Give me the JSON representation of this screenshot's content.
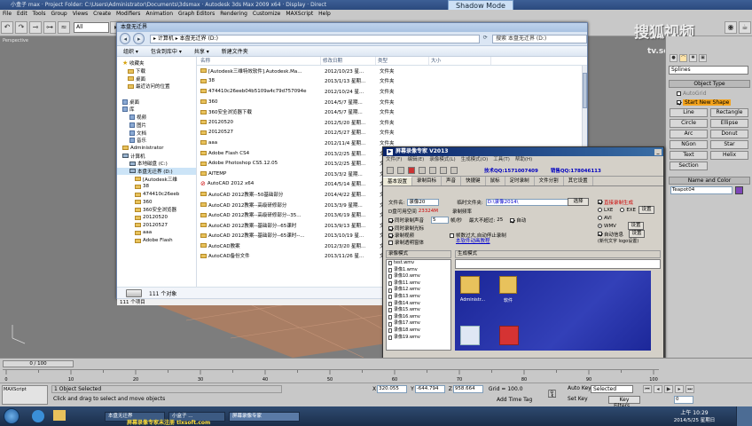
{
  "max": {
    "title": "小盒子 max  ·  Project Folder: C:\\Users\\Administrator\\Documents\\3dsmax  ·  Autodesk 3ds Max  2009 x64  ·  Display  ·  Direct",
    "menu": [
      "File",
      "Edit",
      "Tools",
      "Group",
      "Views",
      "Create",
      "Modifiers",
      "Animation",
      "Graph Editors",
      "Rendering",
      "Customize",
      "MAXScript",
      "Help"
    ],
    "shadow_mode": "Shadow Mode",
    "selection_filter": "All",
    "viewport_label": "Perspective",
    "watermark": "搜狐视频",
    "watermark_url": "tv.sohu.com",
    "cmd_dropdown": "Splines",
    "object_type_header": "Object Type",
    "autogrid": "AutoGrid",
    "start_new_shape": "Start New Shape",
    "shape_buttons": [
      "Line",
      "Rectangle",
      "Circle",
      "Ellipse",
      "Arc",
      "Donut",
      "NGon",
      "Star",
      "Text",
      "Helix",
      "Section"
    ],
    "name_color_header": "Name and Color",
    "object_name": "Teapot04",
    "time_slider": "0 / 100",
    "ruler_ticks": [
      "0",
      "10",
      "20",
      "30",
      "40",
      "50",
      "60",
      "70",
      "80",
      "90",
      "100"
    ],
    "maxscript_label": "MAXScript",
    "status_selected": "1 Object Selected",
    "status_prompt": "Click and drag to select and move objects",
    "coord_x": "320.055",
    "coord_y": "-644.794",
    "coord_z": "958.664",
    "grid": "Grid = 100.0",
    "add_time_tag": "Add Time Tag",
    "auto_key": "Auto Key",
    "auto_key_value": "Selected",
    "set_key": "Set Key",
    "key_filters": "Key Filters...",
    "frame_value": "0",
    "accent_color": "#f4a31b"
  },
  "explorer": {
    "caption": "本盘无迁界",
    "breadcrumb": "▸ 计算机 ▸ 本盘无迁界 (D:)",
    "search_placeholder": "搜索 本盘无迁界 (D:)",
    "commands": [
      "组织 ▾",
      "包含到库中 ▾",
      "共享 ▾",
      "新建文件夹"
    ],
    "columns": [
      "名称",
      "修改日期",
      "类型",
      "大小"
    ],
    "nav": [
      {
        "label": "收藏夹",
        "icon": "star"
      },
      {
        "label": "下载",
        "icon": "folder"
      },
      {
        "label": "桌面",
        "icon": "folder"
      },
      {
        "label": "最近访问的位置",
        "icon": "folder"
      },
      {
        "label": "",
        "icon": "none"
      },
      {
        "label": "桌面",
        "icon": "lib"
      },
      {
        "label": "库",
        "icon": "lib"
      },
      {
        "label": "视频",
        "icon": "lib"
      },
      {
        "label": "图片",
        "icon": "lib"
      },
      {
        "label": "文档",
        "icon": "lib"
      },
      {
        "label": "音乐",
        "icon": "lib"
      },
      {
        "label": "Administrator",
        "icon": "folder"
      },
      {
        "label": "计算机",
        "icon": "pc"
      },
      {
        "label": "本地磁盘 (C:)",
        "icon": "pc"
      },
      {
        "label": "本盘无迁界 (D:)",
        "icon": "pc"
      },
      {
        "label": "[Autodesk三维",
        "icon": "folder"
      },
      {
        "label": "38",
        "icon": "folder"
      },
      {
        "label": "474410c26eeb",
        "icon": "folder"
      },
      {
        "label": "360",
        "icon": "folder"
      },
      {
        "label": "360安全浏览器",
        "icon": "folder"
      },
      {
        "label": "20120520",
        "icon": "folder"
      },
      {
        "label": "20120527",
        "icon": "folder"
      },
      {
        "label": "aaa",
        "icon": "folder"
      },
      {
        "label": "Adobe Flash",
        "icon": "folder"
      }
    ],
    "files": [
      {
        "name": "[Autodesk三维特效软件].Autodesk.Ma...",
        "date": "2012/10/23 星...",
        "type": "文件夹"
      },
      {
        "name": "38",
        "date": "2013/1/13 星期...",
        "type": "文件夹"
      },
      {
        "name": "474410c26eeb04b5109a4c79d757094e",
        "date": "2012/10/24 星...",
        "type": "文件夹"
      },
      {
        "name": "360",
        "date": "2014/5/7 星期...",
        "type": "文件夹"
      },
      {
        "name": "360安全浏览器下载",
        "date": "2014/5/7 星期...",
        "type": "文件夹"
      },
      {
        "name": "20120520",
        "date": "2012/5/20 星期...",
        "type": "文件夹"
      },
      {
        "name": "20120527",
        "date": "2012/5/27 星期...",
        "type": "文件夹"
      },
      {
        "name": "aaa",
        "date": "2012/11/4 星期...",
        "type": "文件夹"
      },
      {
        "name": "Adobe Flash CS4",
        "date": "2013/2/25 星期...",
        "type": "文件夹"
      },
      {
        "name": "Adobe Photoshop CS5.12.05",
        "date": "2013/2/25 星期...",
        "type": "文件夹"
      },
      {
        "name": "AITEMP",
        "date": "2013/3/2 星期...",
        "type": "文件夹"
      },
      {
        "name": "AutoCAD 2012 x64",
        "date": "2014/5/14 星期...",
        "type": "文件夹"
      },
      {
        "name": "AutoCAD 2012教案--50基础部分",
        "date": "2014/4/22 星期...",
        "type": "文件夹"
      },
      {
        "name": "AutoCAD 2012教案--高级研修部分",
        "date": "2013/3/9 星期...",
        "type": "文件夹"
      },
      {
        "name": "AutoCAD 2012教案--高级研修部分--35...",
        "date": "2013/6/19 星期...",
        "type": "文件夹"
      },
      {
        "name": "AutoCAD 2012教案--基础部分--65课时",
        "date": "2013/9/13 星期...",
        "type": "文件夹"
      },
      {
        "name": "AutoCAD 2012教案--基础部分--65课时--...",
        "date": "2013/10/19 星...",
        "type": "文件夹"
      },
      {
        "name": "AutoCAD教案",
        "date": "2012/3/20 星期...",
        "type": "文件夹"
      },
      {
        "name": "AutoCAD备份文件",
        "date": "2013/11/26 星...",
        "type": "文件夹"
      }
    ],
    "details_count": "111 个对象",
    "status_count": "111 个项目"
  },
  "recorder": {
    "title": "屏幕录像专家 V2013",
    "menu": [
      "文件(F)",
      "编辑(E)",
      "录像模式(L)",
      "生成模式(O)",
      "工具(T)",
      "帮助(H)"
    ],
    "tech_qq": "技术QQ:1571007409",
    "sales_qq": "销售QQ:178046113",
    "tabs": [
      "基本设置",
      "录制目标",
      "声音",
      "快捷键",
      "鼠标",
      "定时录制",
      "文件分割",
      "其它设置"
    ],
    "filename_label": "文件名:",
    "filename_value": "录像20",
    "temp_label": "临时文件夹:",
    "temp_value": "D:\\录像2014\\",
    "choose_btn": "选择",
    "disk_free_label": "D盘可用空间",
    "disk_free_value": "23324M",
    "record_freq_label": "录制频率",
    "fps_value": "5",
    "fps_unit": "帧/秒",
    "max_label": "最大不超过:",
    "max_value": "25",
    "auto_label": "自动",
    "opt_audio": "同时录制声音",
    "opt_cursor": "同时录制光标",
    "opt_video": "录制视频",
    "opt_transparent": "录制透明窗体",
    "opt_freeze": "帧数过大,自动停止录制",
    "tutorial_link": "本软件动画教程",
    "direct_label": "直接录制生成",
    "format_lxe": "LXE",
    "format_exe": "EXE",
    "format_avi": "AVI",
    "format_wmv": "WMV",
    "set_btn": "设置",
    "auto_info": "自动信息",
    "logo_label": "(新代文字 logo设置)",
    "rec_mode_label": "录像模式",
    "gen_mode_label": "生成模式",
    "recordings": [
      "test.wmv",
      "录像1.wmv",
      "录像10.wmv",
      "录像11.wmv",
      "录像12.wmv",
      "录像13.wmv",
      "录像14.wmv",
      "录像15.wmv",
      "录像16.wmv",
      "录像17.wmv",
      "录像18.wmv",
      "录像19.wmv"
    ],
    "preview_icons": [
      "Administr...",
      "软件"
    ]
  },
  "taskbar": {
    "tasks": [
      "本盘无迁界",
      "小盒子 ...",
      "屏幕录像专家"
    ],
    "caption_line": "屏幕录像专家未注册 tlxsoft.com",
    "time": "上午 10:29",
    "date": "2014/5/25 星期日"
  }
}
